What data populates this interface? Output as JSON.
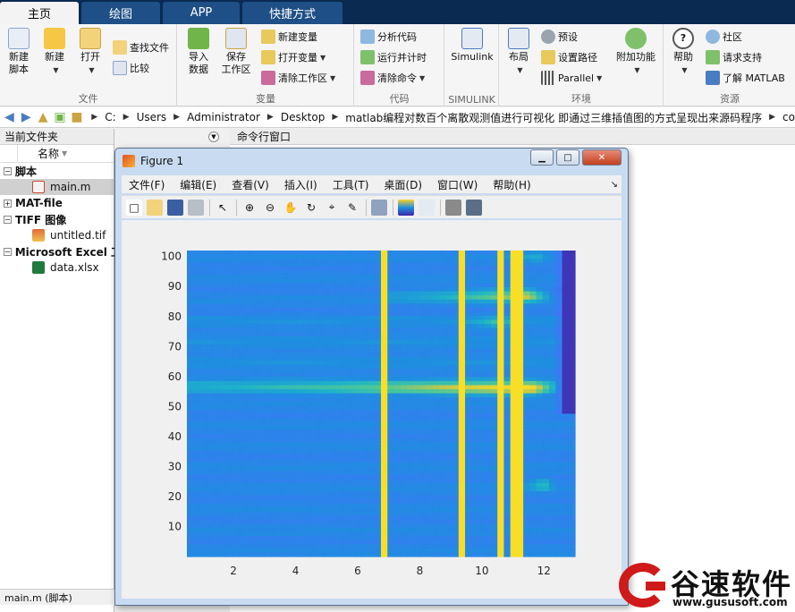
{
  "tabs": [
    {
      "label": "主页",
      "active": true
    },
    {
      "label": "绘图",
      "active": false
    },
    {
      "label": "APP",
      "active": false
    },
    {
      "label": "快捷方式",
      "active": false
    }
  ],
  "ribbon": {
    "file": {
      "title": "文件",
      "new_script": "新建\n脚本",
      "new": "新建",
      "open": "打开",
      "find_files": "查找文件",
      "compare": "比较"
    },
    "variable": {
      "title": "变量",
      "import": "导入\n数据",
      "save_workspace": "保存\n工作区",
      "new_variable": "新建变量",
      "open_variable": "打开变量",
      "clear_workspace": "清除工作区"
    },
    "code": {
      "title": "代码",
      "analyze": "分析代码",
      "run_time": "运行并计时",
      "clear_commands": "清除命令"
    },
    "simulink": {
      "title": "SIMULINK",
      "simulink": "Simulink"
    },
    "environment": {
      "title": "环境",
      "layout": "布局",
      "preferences": "预设",
      "set_path": "设置路径",
      "parallel": "Parallel",
      "addons": "附加功能"
    },
    "resources": {
      "title": "资源",
      "help": "帮助",
      "community": "社区",
      "request_support": "请求支持",
      "learn_matlab": "了解 MATLAB"
    }
  },
  "address": {
    "crumbs": [
      "C:",
      "Users",
      "Administrator",
      "Desktop",
      "matlab编程对数百个离散观测值进行可视化 即通过三维插值图的方式呈现出来源码程序",
      "co"
    ]
  },
  "folder_panel": {
    "title": "当前文件夹",
    "column_name": "名称",
    "groups": [
      {
        "label": "脚本",
        "expanded": true,
        "files": [
          {
            "name": "main.m",
            "icon": "m-file-icon",
            "selected": true
          }
        ]
      },
      {
        "label": "MAT-file",
        "expanded": false,
        "files": []
      },
      {
        "label": "TIFF 图像",
        "expanded": true,
        "files": [
          {
            "name": "untitled.tif",
            "icon": "image-file-icon",
            "selected": false
          }
        ]
      },
      {
        "label": "Microsoft Excel 工",
        "expanded": true,
        "files": [
          {
            "name": "data.xlsx",
            "icon": "excel-file-icon",
            "selected": false
          }
        ]
      }
    ],
    "status": "main.m  (脚本)"
  },
  "command_window": {
    "title": "命令行窗口"
  },
  "figure": {
    "title": "Figure 1",
    "menu": [
      "文件(F)",
      "编辑(E)",
      "查看(V)",
      "插入(I)",
      "工具(T)",
      "桌面(D)",
      "窗口(W)",
      "帮助(H)"
    ],
    "toolbar_icons": [
      "new-figure-icon",
      "open-icon",
      "save-icon",
      "print-icon",
      "pointer-icon",
      "zoom-in-icon",
      "zoom-out-icon",
      "pan-icon",
      "rotate-3d-icon",
      "data-cursor-icon",
      "brush-icon",
      "link-plot-icon",
      "colorbar-icon",
      "legend-icon",
      "hide-plot-tools-icon",
      "show-plot-tools-icon"
    ]
  },
  "chart_data": {
    "type": "heatmap",
    "xlim": [
      0.5,
      13.0
    ],
    "ylim": [
      0,
      102
    ],
    "x_ticks": [
      2,
      4,
      6,
      8,
      10,
      12
    ],
    "y_ticks": [
      10,
      20,
      30,
      40,
      50,
      60,
      70,
      80,
      90,
      100
    ],
    "colormap": "parula",
    "colors": {
      "low": "#3e26a8",
      "mid": "#1f8ee0",
      "high": "#f9d227"
    },
    "background_value": 0.38,
    "hotspots": [
      {
        "y": 56,
        "x_start": 0.5,
        "x_end": 12.6,
        "peak_x": 11.6,
        "intensity": 0.95
      },
      {
        "y": 87,
        "x_start": 7.0,
        "x_end": 12.3,
        "peak_x": 11.5,
        "intensity": 0.85
      },
      {
        "y": 78,
        "x_start": 9.5,
        "x_end": 11.2,
        "peak_x": 10.5,
        "intensity": 0.6
      },
      {
        "y": 100,
        "x_start": 10.8,
        "x_end": 12.2,
        "peak_x": 11.8,
        "intensity": 0.55
      },
      {
        "y": 24,
        "x_start": 11.3,
        "x_end": 12.4,
        "peak_x": 12.0,
        "intensity": 0.65
      }
    ],
    "low_edge": {
      "x_start": 12.4,
      "x_end": 13.0,
      "y_start": 48,
      "y_end": 102,
      "value": 0.05
    }
  },
  "watermark": {
    "text": "谷速软件",
    "url": "www.gususoft.com"
  }
}
